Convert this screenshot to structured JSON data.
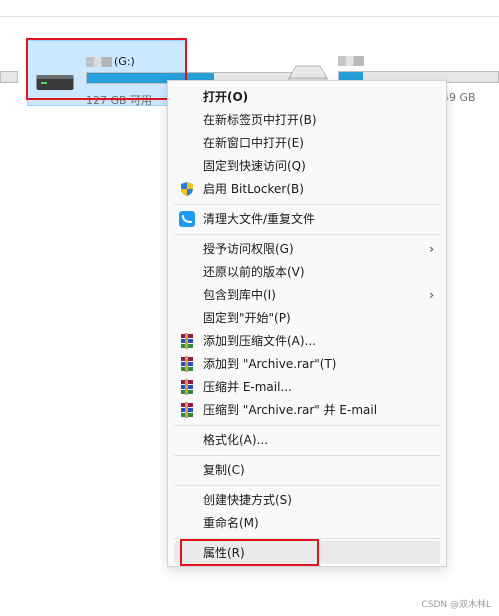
{
  "drives": [
    {
      "label": "(G:)",
      "free": "127 GB 可用",
      "usage_fraction": 0.6
    },
    {
      "label": "",
      "free": "49 GB",
      "usage_fraction": 0.15
    }
  ],
  "context_menu": {
    "items": [
      {
        "label": "打开(O)",
        "bold": true
      },
      {
        "label": "在新标签页中打开(B)"
      },
      {
        "label": "在新窗口中打开(E)"
      },
      {
        "label": "固定到快速访问(Q)"
      },
      {
        "label": "启用 BitLocker(B)",
        "icon": "bitlocker-shield-icon"
      },
      {
        "label": "清理大文件/重复文件",
        "icon": "cleanup-app-icon"
      },
      {
        "label": "授予访问权限(G)",
        "submenu": true
      },
      {
        "label": "还原以前的版本(V)"
      },
      {
        "label": "包含到库中(I)",
        "submenu": true
      },
      {
        "label": "固定到\"开始\"(P)"
      },
      {
        "label": "添加到压缩文件(A)...",
        "icon": "winrar-icon"
      },
      {
        "label": "添加到 \"Archive.rar\"(T)",
        "icon": "winrar-icon"
      },
      {
        "label": "压缩并 E-mail...",
        "icon": "winrar-icon"
      },
      {
        "label": "压缩到 \"Archive.rar\" 并 E-mail",
        "icon": "winrar-icon"
      },
      {
        "label": "格式化(A)..."
      },
      {
        "label": "复制(C)"
      },
      {
        "label": "创建快捷方式(S)"
      },
      {
        "label": "重命名(M)"
      },
      {
        "label": "属性(R)",
        "highlighted": true
      }
    ],
    "submenu_arrow": "›"
  },
  "watermark": "CSDN @双木林L",
  "colors": {
    "selection_bg": "#cce8ff",
    "drive_bar_fill": "#26a0da",
    "annotation_red": "#e0141e",
    "menu_bg": "#f9f9f9"
  }
}
